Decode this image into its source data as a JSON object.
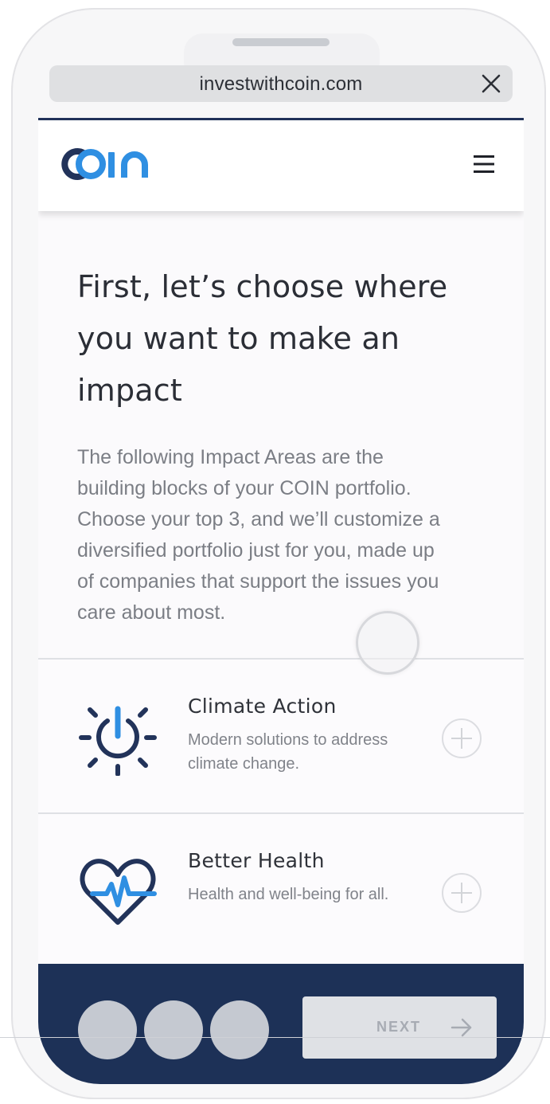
{
  "browser": {
    "url": "investwithcoin.com",
    "close_icon": "close-icon"
  },
  "header": {
    "logo_text": "coin",
    "menu_icon": "hamburger-menu-icon"
  },
  "hero": {
    "title_line1": "First, let’s choose where",
    "title_line2": "you want to make an",
    "title_line3": "impact",
    "body_line1": "The following Impact Areas are the",
    "body_line2": "building blocks of your COIN portfolio.",
    "body_line3": "Choose your top 3, and we’ll customize a",
    "body_line4": "diversified portfolio just for you, made up",
    "body_line5": "of companies that support the issues you",
    "body_line6": "care about most."
  },
  "impact_areas": [
    {
      "title": "Climate Action",
      "desc_line1": "Modern solutions to address",
      "desc_line2": "climate change.",
      "icon": "power-sun-icon"
    },
    {
      "title": "Better Health",
      "desc_line1": "Health and well-being for all.",
      "desc_line2": "",
      "icon": "heart-pulse-icon"
    }
  ],
  "footer": {
    "next_label": "NEXT",
    "next_icon": "arrow-right-icon"
  },
  "colors": {
    "navy": "#1d3157",
    "accent_blue": "#2f8fe2",
    "text_dark": "#2b2e36",
    "text_muted": "#7b7e85"
  }
}
